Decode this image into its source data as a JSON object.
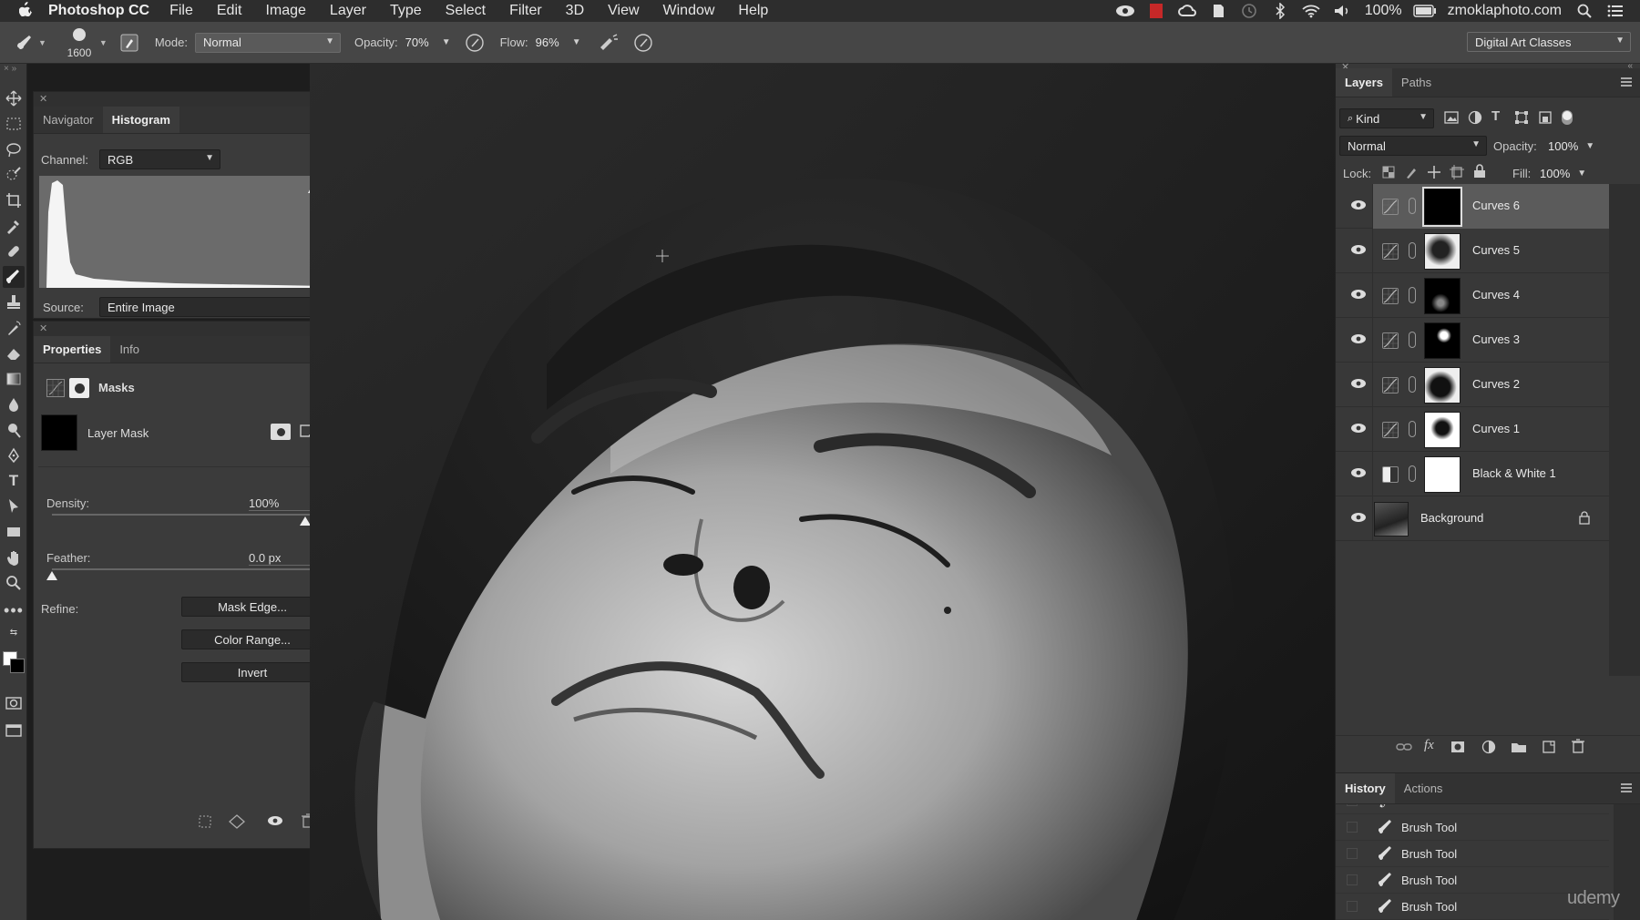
{
  "menubar": {
    "app_name": "Photoshop CC",
    "menus": [
      "File",
      "Edit",
      "Image",
      "Layer",
      "Type",
      "Select",
      "Filter",
      "3D",
      "View",
      "Window",
      "Help"
    ],
    "battery": "100%",
    "site": "zmoklaphoto.com"
  },
  "options": {
    "brush_size": "1600",
    "mode_label": "Mode:",
    "mode_value": "Normal",
    "opacity_label": "Opacity:",
    "opacity_value": "70%",
    "flow_label": "Flow:",
    "flow_value": "96%",
    "workspace": "Digital Art Classes"
  },
  "histogram_panel": {
    "tabs": [
      "Navigator",
      "Histogram"
    ],
    "active_tab": "Histogram",
    "channel_label": "Channel:",
    "channel_value": "RGB",
    "source_label": "Source:",
    "source_value": "Entire Image"
  },
  "properties_panel": {
    "tabs": [
      "Properties",
      "Info"
    ],
    "section": "Masks",
    "mask_name": "Layer Mask",
    "density_label": "Density:",
    "density_value": "100%",
    "density_level": 1.0,
    "feather_label": "Feather:",
    "feather_value": "0.0 px",
    "feather_level": 0.0,
    "refine_label": "Refine:",
    "buttons": [
      "Mask Edge...",
      "Color Range...",
      "Invert"
    ]
  },
  "layers_panel": {
    "tabs": [
      "Layers",
      "Paths"
    ],
    "filter_label": "Kind",
    "blend_mode": "Normal",
    "opacity_label": "Opacity:",
    "opacity_value": "100%",
    "lock_label": "Lock:",
    "fill_label": "Fill:",
    "fill_value": "100%",
    "layers": [
      {
        "name": "Curves 6",
        "selected": true
      },
      {
        "name": "Curves 5",
        "selected": false
      },
      {
        "name": "Curves 4",
        "selected": false
      },
      {
        "name": "Curves 3",
        "selected": false
      },
      {
        "name": "Curves 2",
        "selected": false
      },
      {
        "name": "Curves 1",
        "selected": false
      },
      {
        "name": "Black & White 1",
        "selected": false
      },
      {
        "name": "Background",
        "selected": false
      }
    ]
  },
  "history_panel": {
    "tabs": [
      "History",
      "Actions"
    ],
    "items": [
      "Brush Tool",
      "Brush Tool",
      "Brush Tool",
      "Brush Tool"
    ]
  },
  "watermark": "udemy",
  "colors": {
    "panel_bg": "#3b3b3b",
    "menubar_bg": "#2d2d2d",
    "selected_layer": "#5b5b5b"
  }
}
